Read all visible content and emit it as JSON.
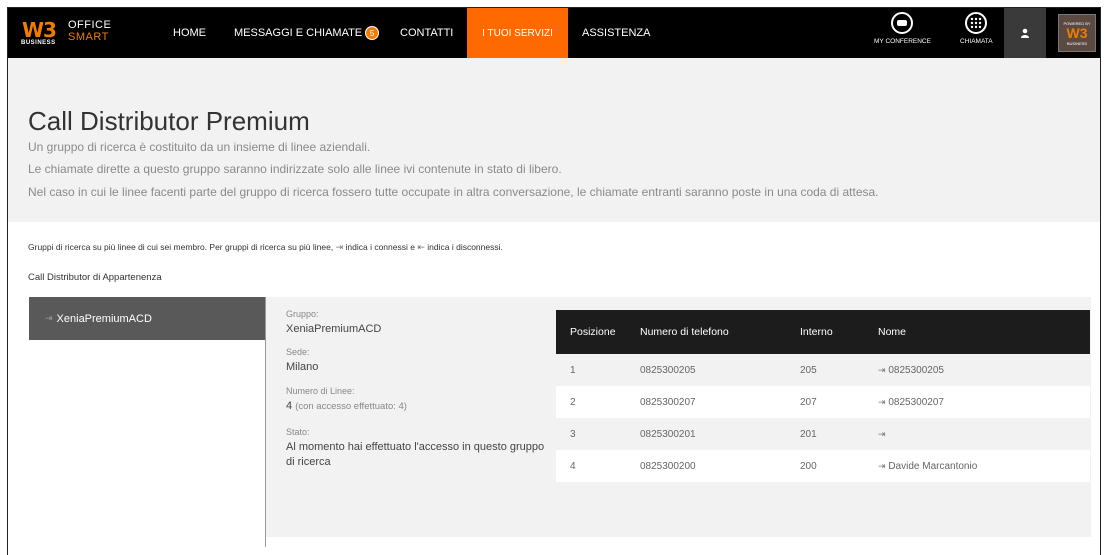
{
  "brand": {
    "logo_w3": "W3",
    "logo_business": "BUSINESS",
    "office": "OFFICE",
    "smart": "SMART",
    "powered_by": "POWERED BY",
    "powered_business": "BUSINESS"
  },
  "nav": {
    "home": "HOME",
    "messaggi": "MESSAGGI E CHIAMATE",
    "messaggi_count": "5",
    "contatti": "CONTATTI",
    "servizi": "I TUOI SERVIZI",
    "assistenza": "ASSISTENZA",
    "my_conference": "MY CONFERENCE",
    "chiamata": "CHIAMATA"
  },
  "page": {
    "title": "Call Distributor Premium",
    "desc1": "Un gruppo di ricerca è costituito da un insieme di linee aziendali.",
    "desc2": "Le chiamate dirette a questo gruppo saranno indirizzate solo alle linee ivi contenute in stato di libero.",
    "desc3": "Nel caso in cui le linee facenti parte del gruppo di ricerca fossero tutte occupate in altra conversazione, le chiamate entranti saranno poste in una coda di attesa.",
    "info_part1": "Gruppi di ricerca su più linee di cui sei membro. Per gruppi di ricerca su più linee,",
    "info_part2": "indica i connessi e",
    "info_part3": "indica i disconnessi.",
    "subtitle": "Call Distributor di Appartenenza"
  },
  "groups": {
    "selected": "XeniaPremiumACD"
  },
  "detail": {
    "gruppo_label": "Gruppo:",
    "gruppo_value": "XeniaPremiumACD",
    "sede_label": "Sede:",
    "sede_value": "Milano",
    "linee_label": "Numero di Linee:",
    "linee_value": "4",
    "linee_extra": "(con accesso effettuato: 4)",
    "stato_label": "Stato:",
    "stato_value": "Al momento hai effettuato l'accesso in questo gruppo di ricerca"
  },
  "table": {
    "headers": [
      "Posizione",
      "Numero di telefono",
      "Interno",
      "Nome"
    ],
    "rows": [
      [
        "1",
        "0825300205",
        "205",
        "0825300205"
      ],
      [
        "2",
        "0825300207",
        "207",
        "0825300207"
      ],
      [
        "3",
        "0825300201",
        "201",
        ""
      ],
      [
        "4",
        "0825300200",
        "200",
        "Davide Marcantonio"
      ]
    ]
  },
  "colors": {
    "accent": "#ff6a00",
    "brand_orange": "#f07d00",
    "nav_bg": "#000000",
    "group_bg": "#595959",
    "table_header_bg": "#1c1c1c"
  },
  "icons": {
    "connected": "login-arrow-icon",
    "disconnected": "logout-arrow-icon",
    "user": "user-icon",
    "conference": "conference-icon",
    "keypad": "keypad-icon"
  }
}
